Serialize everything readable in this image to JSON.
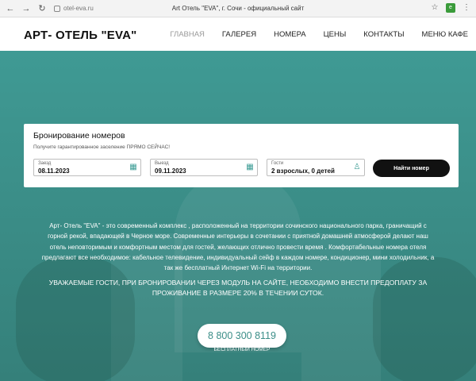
{
  "browser": {
    "url": "otel-eva.ru",
    "tab_title": "Art Отель \"EVA\", г. Сочи - официальный сайт"
  },
  "header": {
    "logo": "АРТ- ОТЕЛЬ \"EVA\"",
    "nav": [
      {
        "label": "ГЛАВНАЯ",
        "active": true
      },
      {
        "label": "ГАЛЕРЕЯ",
        "active": false
      },
      {
        "label": "НОМЕРА",
        "active": false
      },
      {
        "label": "ЦЕНЫ",
        "active": false
      },
      {
        "label": "КОНТАКТЫ",
        "active": false
      },
      {
        "label": "МЕНЮ КАФЕ",
        "active": false
      }
    ]
  },
  "booking": {
    "title": "Бронирование номеров",
    "subtitle": "Получите гарантированное заселение ПРЯМО СЕЙЧАС!",
    "checkin": {
      "label": "Заезд",
      "value": "08.11.2023"
    },
    "checkout": {
      "label": "Выезд",
      "value": "09.11.2023"
    },
    "guests": {
      "label": "Гости",
      "value": "2 взрослых, 0 детей"
    },
    "search_button": "Найти номер"
  },
  "hero": {
    "description": "Арт- Отель \"EVA\" - это современный комплекс , расположенный на территории сочинского национального парка, граничащий с горной рекой, впадающей в Черное море. Современные интерьеры в сочетании с приятной домашней атмосферой делают наш отель неповторимым и комфортным местом для гостей, желающих отлично провести время . Комфортабельные номера отеля предлагают все необходимое: кабельное телевидение, индивидуальный сейф в каждом номере, кондиционер, мини холодильник, а так же бесплатный Интернет Wi-Fi на территории.",
    "notice": "УВАЖАЕМЫЕ ГОСТИ, ПРИ БРОНИРОВАНИИ ЧЕРЕЗ МОДУЛЬ НА САЙТЕ, НЕОБХОДИМО ВНЕСТИ ПРЕДОПЛАТУ ЗА ПРОЖИВАНИЕ В РАЗМЕРЕ 20% В ТЕЧЕНИИ СУТОК.",
    "phone": "8 800 300 8119",
    "phone_caption": "БЕСПЛАТНЫЙ НОМЕР"
  },
  "colors": {
    "accent": "#3b8e88",
    "button_dark": "#111111",
    "nav_active": "#9a9a9a"
  }
}
